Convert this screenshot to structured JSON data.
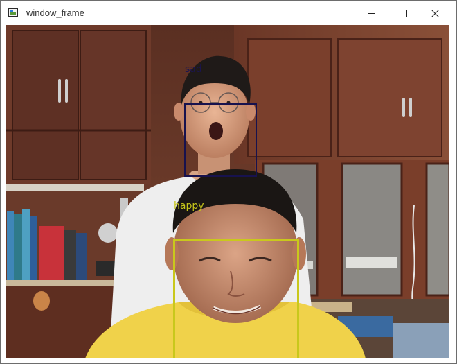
{
  "window": {
    "title": "window_frame",
    "icons": {
      "app": "app-window-icon",
      "minimize": "minimize-icon",
      "maximize": "maximize-icon",
      "close": "close-icon"
    }
  },
  "detections": [
    {
      "label": "sad",
      "color": "#17124e"
    },
    {
      "label": "happy",
      "color": "#c9c81c"
    }
  ]
}
